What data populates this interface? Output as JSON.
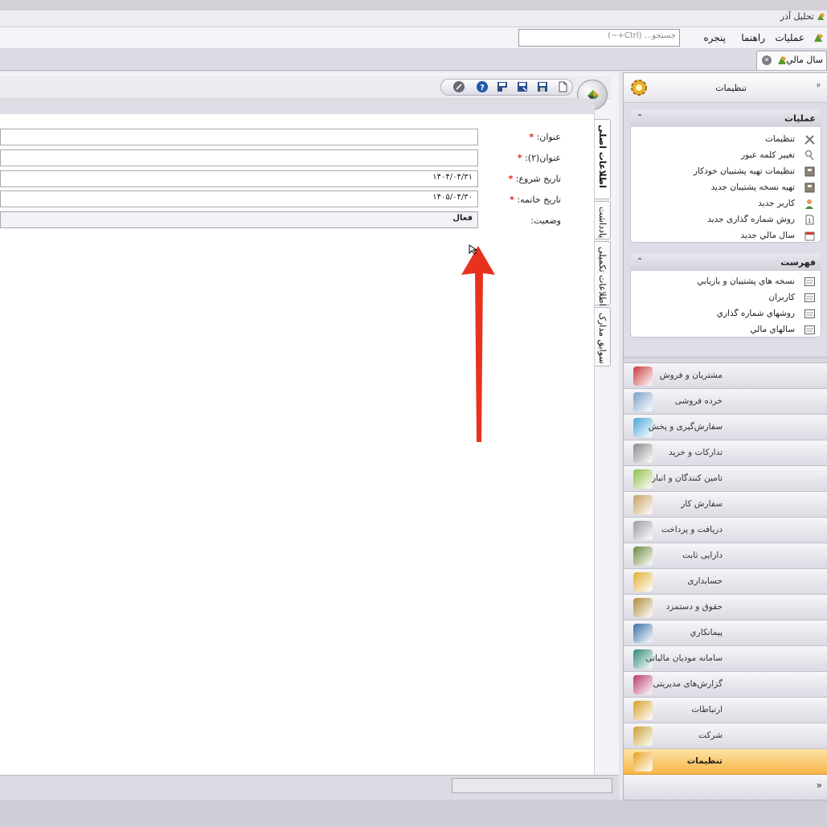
{
  "app": {
    "title": "تحلیل آذر"
  },
  "menu": {
    "items": [
      "عملیات",
      "راهنما",
      "پنجره"
    ],
    "search_placeholder": "جستجو... (Ctrl+~)"
  },
  "doc_tab": {
    "label": "سال مالي"
  },
  "vertical_tabs": [
    "اطلاعات اصلی",
    "یادداشت",
    "اطلاعات تکمیلی",
    "سوابق مدارک"
  ],
  "form": {
    "fields": [
      {
        "label": "عنوان:",
        "required": true,
        "value": ""
      },
      {
        "label": "عنوان(۲):",
        "required": true,
        "value": ""
      },
      {
        "label": "تاریخ شروع:",
        "required": true,
        "value": "۱۴۰۴/۰۴/۳۱"
      },
      {
        "label": "تاریخ خاتمه:",
        "required": true,
        "value": "۱۴۰۵/۰۴/۳۰"
      },
      {
        "label": "وضعیت:",
        "required": false,
        "value": "فعال"
      }
    ],
    "required_mark": "*"
  },
  "right_panel": {
    "title": "تنظیمات",
    "pin": "ᵖ",
    "operations": {
      "title": "عملیات",
      "items": [
        "تنظیمات",
        "تغییر کلمه عبور",
        "تنظیمات تهیه پشتیبان خودکار",
        "تهیه نسخه پشتیبان جدید",
        "کاربر جدید",
        "روش شماره گذاری جدید",
        "سال مالي جديد"
      ]
    },
    "list": {
      "title": "فهرست",
      "items": [
        "نسخه هاي پشتيبان و بازيابي",
        "کاربران",
        "روشهاي شماره گذاري",
        "سالهاي مالي"
      ]
    },
    "nav": [
      {
        "label": "مشتریان و فروش",
        "color": "#c9393b"
      },
      {
        "label": "خرده فروشی",
        "color": "#7aa0c8"
      },
      {
        "label": "سفارش‌گیری و پخش",
        "color": "#4aa6d8"
      },
      {
        "label": "تدارکات و خرید",
        "color": "#8a8a8a"
      },
      {
        "label": "تامین کنندگان و انبار",
        "color": "#8fbf4a"
      },
      {
        "label": "سفارش کار",
        "color": "#c8a060"
      },
      {
        "label": "دریافت و پرداخت",
        "color": "#9a9aa0"
      },
      {
        "label": "دارایی ثابت",
        "color": "#6d8a3e"
      },
      {
        "label": "حسابداری",
        "color": "#e0b030"
      },
      {
        "label": "حقوق و دستمزد",
        "color": "#b08a3a"
      },
      {
        "label": "پیمانکاري",
        "color": "#3a6ea8"
      },
      {
        "label": "سامانه مودیان مالیاتی",
        "color": "#2e8a7a"
      },
      {
        "label": "گزارش‌های مدیریتی",
        "color": "#b83a6a"
      },
      {
        "label": "ارتباطات",
        "color": "#d8a028"
      },
      {
        "label": "شرکت",
        "color": "#c8a030"
      },
      {
        "label": "تنظیمات",
        "color": "#e8a020"
      }
    ],
    "active_nav_index": 15,
    "more_label": "»"
  }
}
